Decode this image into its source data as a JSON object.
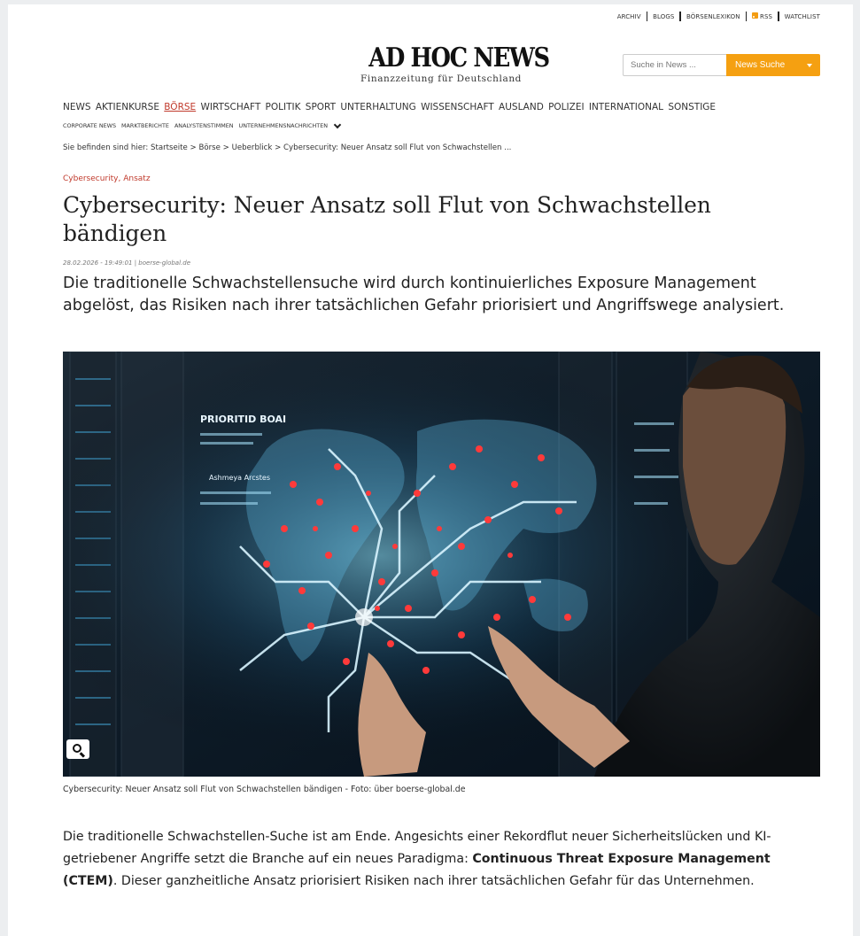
{
  "toplinks": {
    "archiv": "ARCHIV",
    "blogs": "BLOGS",
    "lexikon": "BÖRSENLEXIKON",
    "rss": "RSS",
    "watchlist": "WATCHLIST"
  },
  "logo": {
    "main": "AD HOC NEWS",
    "sub": "Finanzzeitung für Deutschland"
  },
  "search": {
    "placeholder": "Suche in News ...",
    "button": "News Suche"
  },
  "nav": {
    "items": [
      "NEWS",
      "AKTIENKURSE",
      "BÖRSE",
      "WIRTSCHAFT",
      "POLITIK",
      "SPORT",
      "UNTERHALTUNG",
      "WISSENSCHAFT",
      "AUSLAND",
      "POLIZEI",
      "INTERNATIONAL",
      "SONSTIGE"
    ],
    "active": "BÖRSE",
    "sub": [
      "CORPORATE NEWS",
      "MARKTBERICHTE",
      "ANALYSTENSTIMMEN",
      "UNTERNEHMENSNACHRICHTEN"
    ]
  },
  "breadcrumb": "Sie befinden sind hier: Startseite > Börse > Ueberblick > Cybersecurity: Neuer Ansatz soll Flut von Schwachstellen ...",
  "article": {
    "tags": [
      "Cybersecurity",
      "Ansatz"
    ],
    "title": "Cybersecurity: Neuer Ansatz soll Flut von Schwachstellen bändigen",
    "meta": "28.02.2026 - 19:49:01 | boerse-global.de",
    "lead": "Die traditionelle Schwachstellensuche wird durch kontinuierliches Exposure Management abgelöst, das Risiken nach ihrer tatsächlichen Gefahr priorisiert und Angriffswege analysiert.",
    "caption": "Cybersecurity: Neuer Ansatz soll Flut von Schwachstellen bändigen - Foto: über boerse-global.de",
    "body_1": "Die traditionelle Schwachstellen-Suche ist am Ende. Angesichts einer Rekordflut neuer Sicherheitslücken und KI-getriebener Angriffe setzt die Branche auf ein neues Paradigma: ",
    "body_bold": "Continuous Threat Exposure Management (CTEM)",
    "body_2": ". Dieser ganzheitliche Ansatz priorisiert Risiken nach ihrer tatsächlichen Gefahr für das Unternehmen."
  },
  "image": {
    "overlay_text": [
      "PRIORITID BOAI",
      "Ashmeya Arcstes"
    ]
  }
}
